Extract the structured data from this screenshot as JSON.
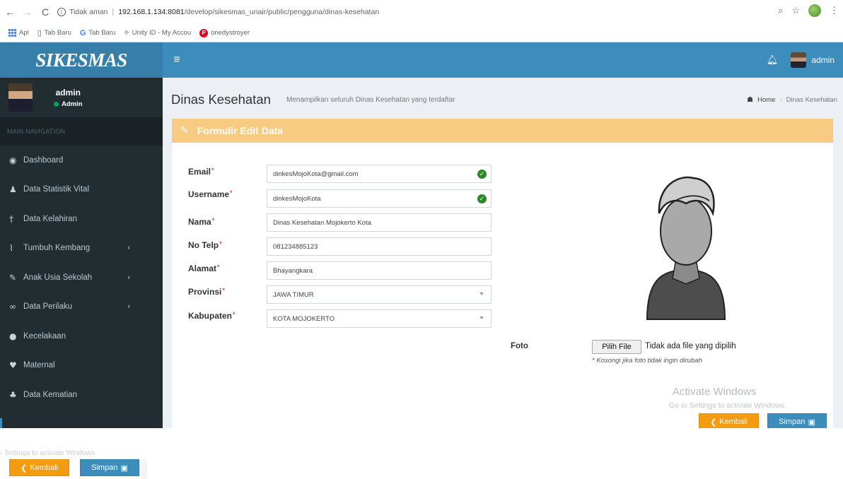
{
  "browser": {
    "nav_back": "←",
    "nav_forward": "→",
    "nav_reload": "C",
    "security_text": "Tidak aman",
    "host": "192.168.1.134:8081",
    "path": "/develop/sikesmas_unair/public/pengguna/dinas-kesehatan",
    "bookmarks": [
      {
        "label": "Apl",
        "icon": "apps-icon"
      },
      {
        "label": "Tab Baru",
        "icon": "page-icon"
      },
      {
        "label": "Tab Baru",
        "icon": "google-icon"
      },
      {
        "label": "Unity ID - My Accou",
        "icon": "unity-icon"
      },
      {
        "label": "onedystroyer",
        "icon": "pinterest-icon"
      }
    ]
  },
  "app": {
    "logo": "SIKESMAS",
    "header_user": "admin"
  },
  "sidebar": {
    "user_name": "admin",
    "user_status": "Admin",
    "nav_header": "MAIN NAVIGATION",
    "items": [
      {
        "label": "Dashboard",
        "icon": "dashboard-icon",
        "glyph": "◉",
        "has_children": false
      },
      {
        "label": "Data Statistik Vital",
        "icon": "user-icon",
        "glyph": "♟",
        "has_children": false
      },
      {
        "label": "Data Kelahiran",
        "icon": "child-icon",
        "glyph": "†",
        "has_children": false
      },
      {
        "label": "Tumbuh Kembang",
        "icon": "line-chart-icon",
        "glyph": "⌇",
        "has_children": true
      },
      {
        "label": "Anak Usia Sekolah",
        "icon": "graduation-cap-icon",
        "glyph": "✎",
        "has_children": true
      },
      {
        "label": "Data Perilaku",
        "icon": "binoculars-icon",
        "glyph": "∞",
        "has_children": true
      },
      {
        "label": "Kecelakaan",
        "icon": "info-icon",
        "glyph": "●",
        "has_children": false
      },
      {
        "label": "Maternal",
        "icon": "heartbeat-icon",
        "glyph": "♥",
        "has_children": false
      },
      {
        "label": "Data Kematian",
        "icon": "user-times-icon",
        "glyph": "♣",
        "has_children": false
      }
    ],
    "chevron": "‹"
  },
  "content": {
    "title": "Dinas Kesehatan",
    "subtitle": "Menampilkan seluruh Dinas Kesehatan yang terdaftar",
    "breadcrumb": [
      "Home",
      "Dinas Kesehatan"
    ],
    "box_title": "Formulir Edit Data",
    "form": {
      "email_label": "Email",
      "email_value": "dinkesMojoKota@gmail.com",
      "username_label": "Username",
      "username_value": "dinkesMojoKota",
      "nama_label": "Nama",
      "nama_value": "Dinas Kesehatan Mojokerto Kota",
      "notelp_label": "No Telp",
      "notelp_value": "081234885123",
      "alamat_label": "Alamat",
      "alamat_value": "Bhayangkara",
      "provinsi_label": "Provinsi",
      "provinsi_value": "JAWA TIMUR",
      "kabupaten_label": "Kabupaten",
      "kabupaten_value": "KOTA MOJOKERTO",
      "required_mark": "*",
      "foto_label": "Foto",
      "file_button": "Pilih File",
      "file_status": "Tidak ada file yang dipilih",
      "file_help": "* Kosongi jika foto tidak ingin dirubah"
    },
    "buttons": {
      "back": "Kembali",
      "save": "Simpan"
    }
  },
  "watermark": {
    "line1": "Activate Windows",
    "line2": "Go to Settings to activate Windows.",
    "fragment": "Settings to activate Windows"
  },
  "colors": {
    "header": "#3c8dbc",
    "logo_bg": "#367fa9",
    "sidebar": "#222d32",
    "box_header": "#f8cb82",
    "warning": "#f39c12",
    "primary": "#3c8dbc"
  }
}
